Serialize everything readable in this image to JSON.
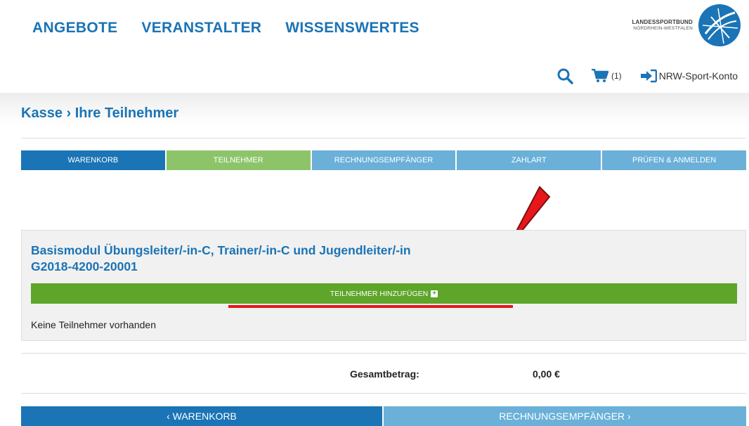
{
  "nav": {
    "items": [
      "ANGEBOTE",
      "VERANSTALTER",
      "WISSENSWERTES"
    ]
  },
  "logo": {
    "line1": "LANDESSPORTBUND",
    "line2": "NORDRHEIN-WESTFALEN"
  },
  "utility": {
    "cart_count": "(1)",
    "account_label": "NRW-Sport-Konto"
  },
  "breadcrumb": "Kasse › Ihre Teilnehmer",
  "steps": [
    {
      "label": "WARENKORB",
      "color": "#1a74b6"
    },
    {
      "label": "TEILNEHMER",
      "color": "#8dc46a"
    },
    {
      "label": "RECHNUNGSEMPFÄNGER",
      "color": "#6ab0d8"
    },
    {
      "label": "ZAHLART",
      "color": "#6ab0d8"
    },
    {
      "label": "PRÜFEN & ANMELDEN",
      "color": "#6ab0d8"
    }
  ],
  "course": {
    "title": "Basismodul Übungsleiter/-in-C, Trainer/-in-C und Jugendleiter/-in",
    "code": "G2018-4200-20001",
    "add_button": "TEILNEHMER HINZUFÜGEN",
    "empty_message": "Keine Teilnehmer vorhanden"
  },
  "total": {
    "label": "Gesamtbetrag:",
    "value": "0,00 €"
  },
  "bottom_nav": {
    "back": "‹ WARENKORB",
    "next": "RECHNUNGSEMPFÄNGER ›"
  },
  "colors": {
    "brand_blue": "#1a74b6",
    "light_blue": "#6ab0d8",
    "green_active": "#8dc46a",
    "green_button": "#5ea52a",
    "annotation_red": "#e8161a"
  }
}
